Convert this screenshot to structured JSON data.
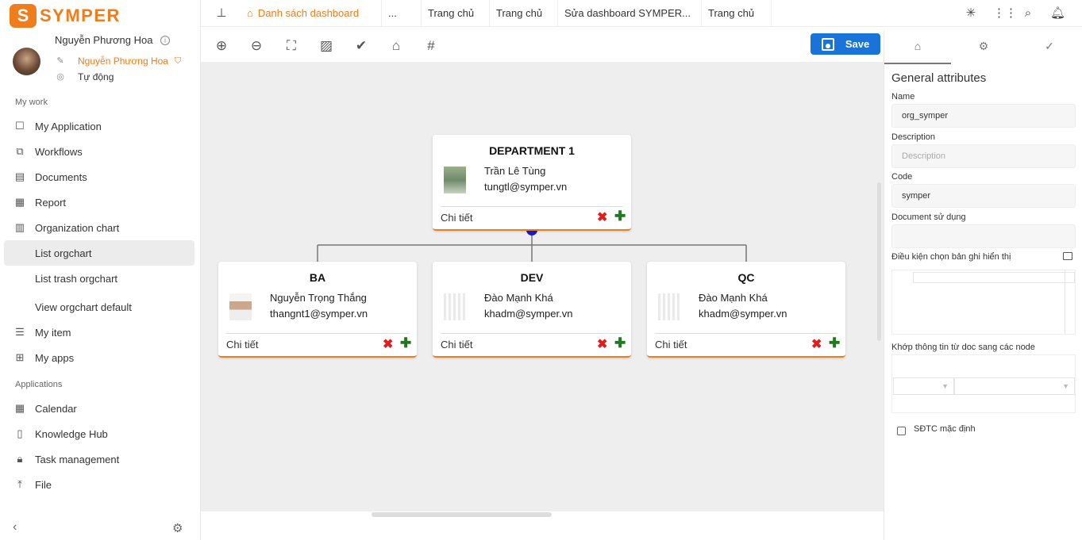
{
  "brand": {
    "name": "SYMPER",
    "mark": "S"
  },
  "user": {
    "name": "Nguyễn Phương Hoa",
    "role": "Nguyễn Phương Hoa",
    "status": "Tự động"
  },
  "sections": {
    "work": "My work",
    "apps": "Applications"
  },
  "nav": [
    {
      "label": "My Application",
      "icon": "app-icon"
    },
    {
      "label": "Workflows",
      "icon": "workflow-icon"
    },
    {
      "label": "Documents",
      "icon": "document-icon"
    },
    {
      "label": "Report",
      "icon": "report-icon"
    },
    {
      "label": "Organization chart",
      "icon": "orgchart-icon"
    },
    {
      "label": "List orgchart"
    },
    {
      "label": "List trash orgchart"
    },
    {
      "label": "View orgchart default"
    },
    {
      "label": "My item",
      "icon": "list-icon"
    },
    {
      "label": "My apps",
      "icon": "apps-icon"
    }
  ],
  "apps_nav": [
    {
      "label": "Calendar",
      "icon": "calendar-icon"
    },
    {
      "label": "Knowledge Hub",
      "icon": "knowledge-icon"
    },
    {
      "label": "Task management",
      "icon": "lock-icon"
    },
    {
      "label": "File",
      "icon": "upload-icon"
    }
  ],
  "tabs": [
    "Danh sách dashboard",
    "...",
    "Trang chủ",
    "Trang chủ",
    "Sửa dashboard SYMPER...",
    "Trang chủ"
  ],
  "save_label": "Save",
  "cards": {
    "root": {
      "title": "DEPARTMENT 1",
      "name": "Trần Lê Tùng",
      "email": "tungtl@symper.vn",
      "detail": "Chi tiết"
    },
    "ba": {
      "title": "BA",
      "name": "Nguyễn Trọng Thắng",
      "email": "thangnt1@symper.vn",
      "detail": "Chi tiết"
    },
    "dev": {
      "title": "DEV",
      "name": "Đào Mạnh Khá",
      "email": "khadm@symper.vn",
      "detail": "Chi tiết"
    },
    "qc": {
      "title": "QC",
      "name": "Đào Mạnh Khá",
      "email": "khadm@symper.vn",
      "detail": "Chi tiết"
    }
  },
  "panel": {
    "title": "General attributes",
    "name_label": "Name",
    "name_value": "org_symper",
    "desc_label": "Description",
    "desc_placeholder": "Description",
    "code_label": "Code",
    "code_value": "symper",
    "doc_label": "Document sử dụng",
    "cond_label": "Điều kiện chọn bản ghi hiển thị",
    "map_label": "Khớp thông tin từ doc sang các node",
    "default_label": "SĐTC mặc định"
  },
  "colors": {
    "accent": "#f07c1c",
    "save": "#1a73d9",
    "delete": "#e51c1c",
    "add": "#1f7a1f",
    "connector": "#1a1acc"
  }
}
